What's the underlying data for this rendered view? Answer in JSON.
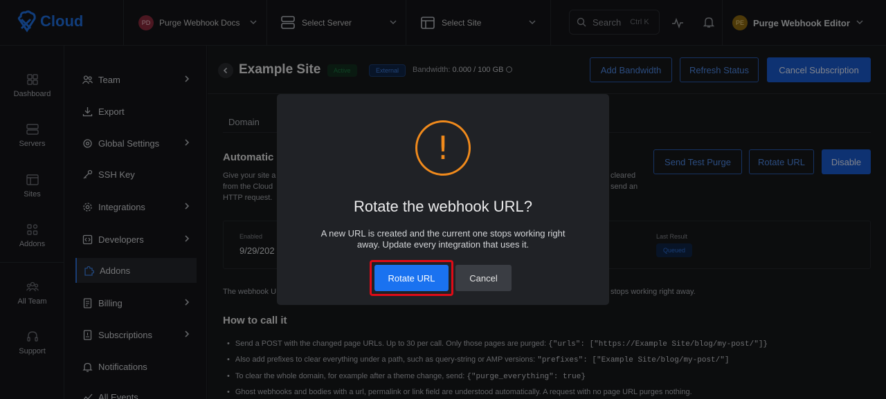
{
  "brand": {
    "name": "Cloud"
  },
  "topbar": {
    "workspace": {
      "initials": "PD",
      "label": "Purge Webhook Docs"
    },
    "server_selector": "Select Server",
    "site_selector": "Select Site",
    "search": {
      "label": "Search",
      "shortcut": "Ctrl K"
    },
    "user": {
      "initials": "PE",
      "name": "Purge Webhook Editor"
    }
  },
  "rail": [
    {
      "label": "Dashboard",
      "icon": "dashboard-icon"
    },
    {
      "label": "Servers",
      "icon": "server-icon"
    },
    {
      "label": "Sites",
      "icon": "sites-icon"
    },
    {
      "label": "Addons",
      "icon": "addons-icon"
    },
    {
      "label": "All Team",
      "icon": "team-icon"
    },
    {
      "label": "Support",
      "icon": "headset-icon"
    }
  ],
  "nav": [
    {
      "label": "Team",
      "icon": "users-icon",
      "has_children": true
    },
    {
      "label": "Export",
      "icon": "download-icon",
      "has_children": false
    },
    {
      "label": "Global Settings",
      "icon": "globe-settings-icon",
      "has_children": true
    },
    {
      "label": "SSH Key",
      "icon": "key-icon",
      "has_children": false
    },
    {
      "label": "Integrations",
      "icon": "gear-icon",
      "has_children": true
    },
    {
      "label": "Developers",
      "icon": "code-icon",
      "has_children": true
    },
    {
      "label": "Addons",
      "icon": "puzzle-icon",
      "has_children": false,
      "active": true
    },
    {
      "label": "Billing",
      "icon": "billing-icon",
      "has_children": true
    },
    {
      "label": "Subscriptions",
      "icon": "subscriptions-icon",
      "has_children": true
    },
    {
      "label": "Notifications",
      "icon": "bell-icon",
      "has_children": false
    },
    {
      "label": "All Events",
      "icon": "events-icon",
      "has_children": false
    }
  ],
  "site": {
    "title": "Example Site",
    "status_badge": "Active",
    "type_badge": "External",
    "bandwidth_label": "Bandwidth:",
    "bandwidth_value": "0.000 / 100 GB"
  },
  "header_actions": {
    "add_bandwidth": "Add Bandwidth",
    "refresh_status": "Refresh Status",
    "cancel_subscription": "Cancel Subscription"
  },
  "tabs": {
    "domain": "Domain"
  },
  "section": {
    "title": "Automatic",
    "desc_line1_left": "Give your site a",
    "desc_line2_left": "from the Cloud",
    "desc_line3": "HTTP request.",
    "desc_line1_right": "cleared",
    "desc_line2_right": "send an",
    "actions": {
      "send_test_purge": "Send Test Purge",
      "rotate_url": "Rotate URL",
      "disable": "Disable"
    }
  },
  "info": {
    "enabled_label": "Enabled",
    "enabled_value": "9/29/202",
    "last_result_label": "Last Result",
    "last_result_value": "Queued"
  },
  "note": {
    "left": "The webhook U",
    "right": "stops working right away."
  },
  "how_to": {
    "title": "How to call it",
    "bullets": [
      {
        "text": "Send a POST with the changed page URLs. Up to 30 per call. Only those pages are purged:",
        "code": "{\"urls\": [\"https://Example Site/blog/my-post/\"]}"
      },
      {
        "text": "Also add prefixes to clear everything under a path, such as query-string or AMP versions:",
        "code": "\"prefixes\": [\"Example Site/blog/my-post/\"]"
      },
      {
        "text": "To clear the whole domain, for example after a theme change, send:",
        "code": "{\"purge_everything\": true}"
      },
      {
        "text": "Ghost webhooks and bodies with a url, permalink or link field are understood automatically. A request with no page URL purges nothing.",
        "code": ""
      }
    ]
  },
  "modal": {
    "icon": "warning-icon",
    "icon_glyph": "!",
    "title": "Rotate the webhook URL?",
    "message": "A new URL is created and the current one stops working right away. Update every integration that uses it.",
    "confirm": "Rotate URL",
    "cancel": "Cancel"
  },
  "colors": {
    "primary": "#1a5bd0",
    "warning": "#f08a1c",
    "highlight": "#e00b16",
    "active_badge": "#1d7a43"
  }
}
